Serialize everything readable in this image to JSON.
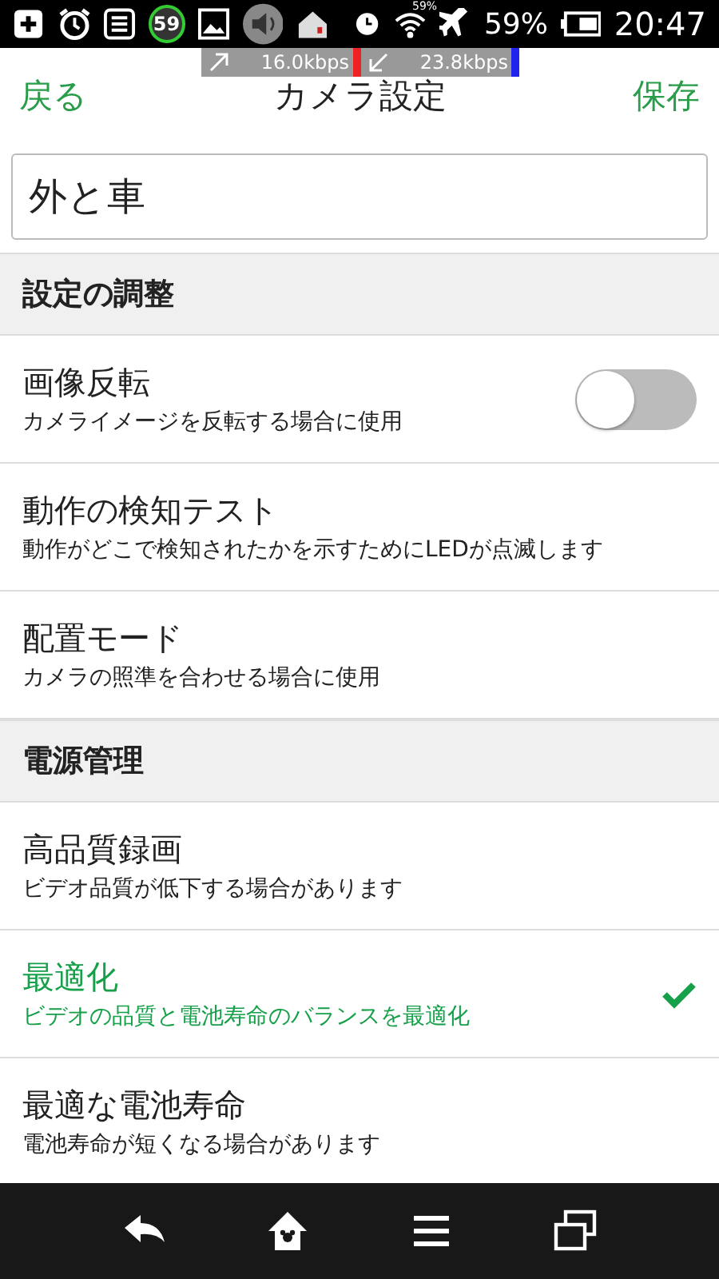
{
  "status_bar": {
    "badge": "59",
    "wifi_label": "59%",
    "battery": "59%",
    "time": "20:47"
  },
  "speed_overlay": {
    "up": "16.0kbps",
    "down": "23.8kbps"
  },
  "nav": {
    "back": "戻る",
    "title": "カメラ設定",
    "save": "保存"
  },
  "name_field": {
    "value": "外と車"
  },
  "sections": [
    {
      "title": "設定の調整",
      "items": [
        {
          "kind": "toggle",
          "title": "画像反転",
          "subtitle": "カメライメージを反転する場合に使用",
          "on": false
        },
        {
          "kind": "plain",
          "title": "動作の検知テスト",
          "subtitle": "動作がどこで検知されたかを示すためにLEDが点滅します"
        },
        {
          "kind": "plain",
          "title": "配置モード",
          "subtitle": "カメラの照準を合わせる場合に使用"
        }
      ]
    },
    {
      "title": "電源管理",
      "items": [
        {
          "kind": "choice",
          "title": "高品質録画",
          "subtitle": "ビデオ品質が低下する場合があります",
          "selected": false
        },
        {
          "kind": "choice",
          "title": "最適化",
          "subtitle": "ビデオの品質と電池寿命のバランスを最適化",
          "selected": true
        },
        {
          "kind": "choice",
          "title": "最適な電池寿命",
          "subtitle": "電池寿命が短くなる場合があります",
          "selected": false
        }
      ]
    }
  ]
}
